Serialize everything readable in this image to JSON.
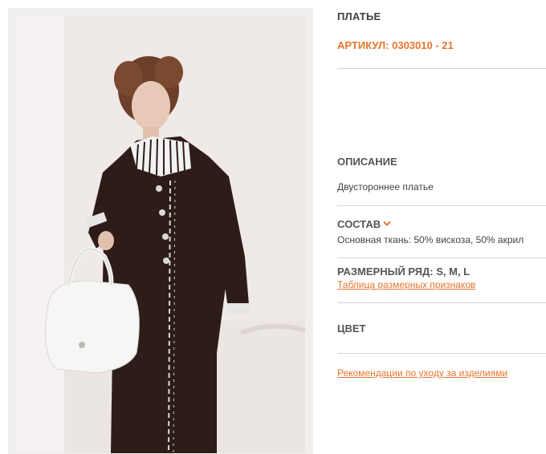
{
  "product": {
    "title": "ПЛАТЬЕ",
    "article_label": "АРТИКУЛ:",
    "article_value": "0303010 - 21"
  },
  "description": {
    "heading": "ОПИСАНИЕ",
    "text": "Двустороннее платье"
  },
  "composition": {
    "heading": "СОСТАВ",
    "toggle_icon": "chevron-down-icon",
    "text": "Основная ткань: 50% вискоза, 50% акрил"
  },
  "sizes": {
    "heading": "РАЗМЕРНЫЙ РЯД:",
    "values": "S, M, L",
    "table_link": "Таблица размерных признаков"
  },
  "color": {
    "heading": "ЦВЕТ"
  },
  "care_link": "Рекомендации по уходу за изделиями",
  "colors": {
    "accent": "#e8752c",
    "dress": "#2e1c18",
    "text": "#444444"
  }
}
